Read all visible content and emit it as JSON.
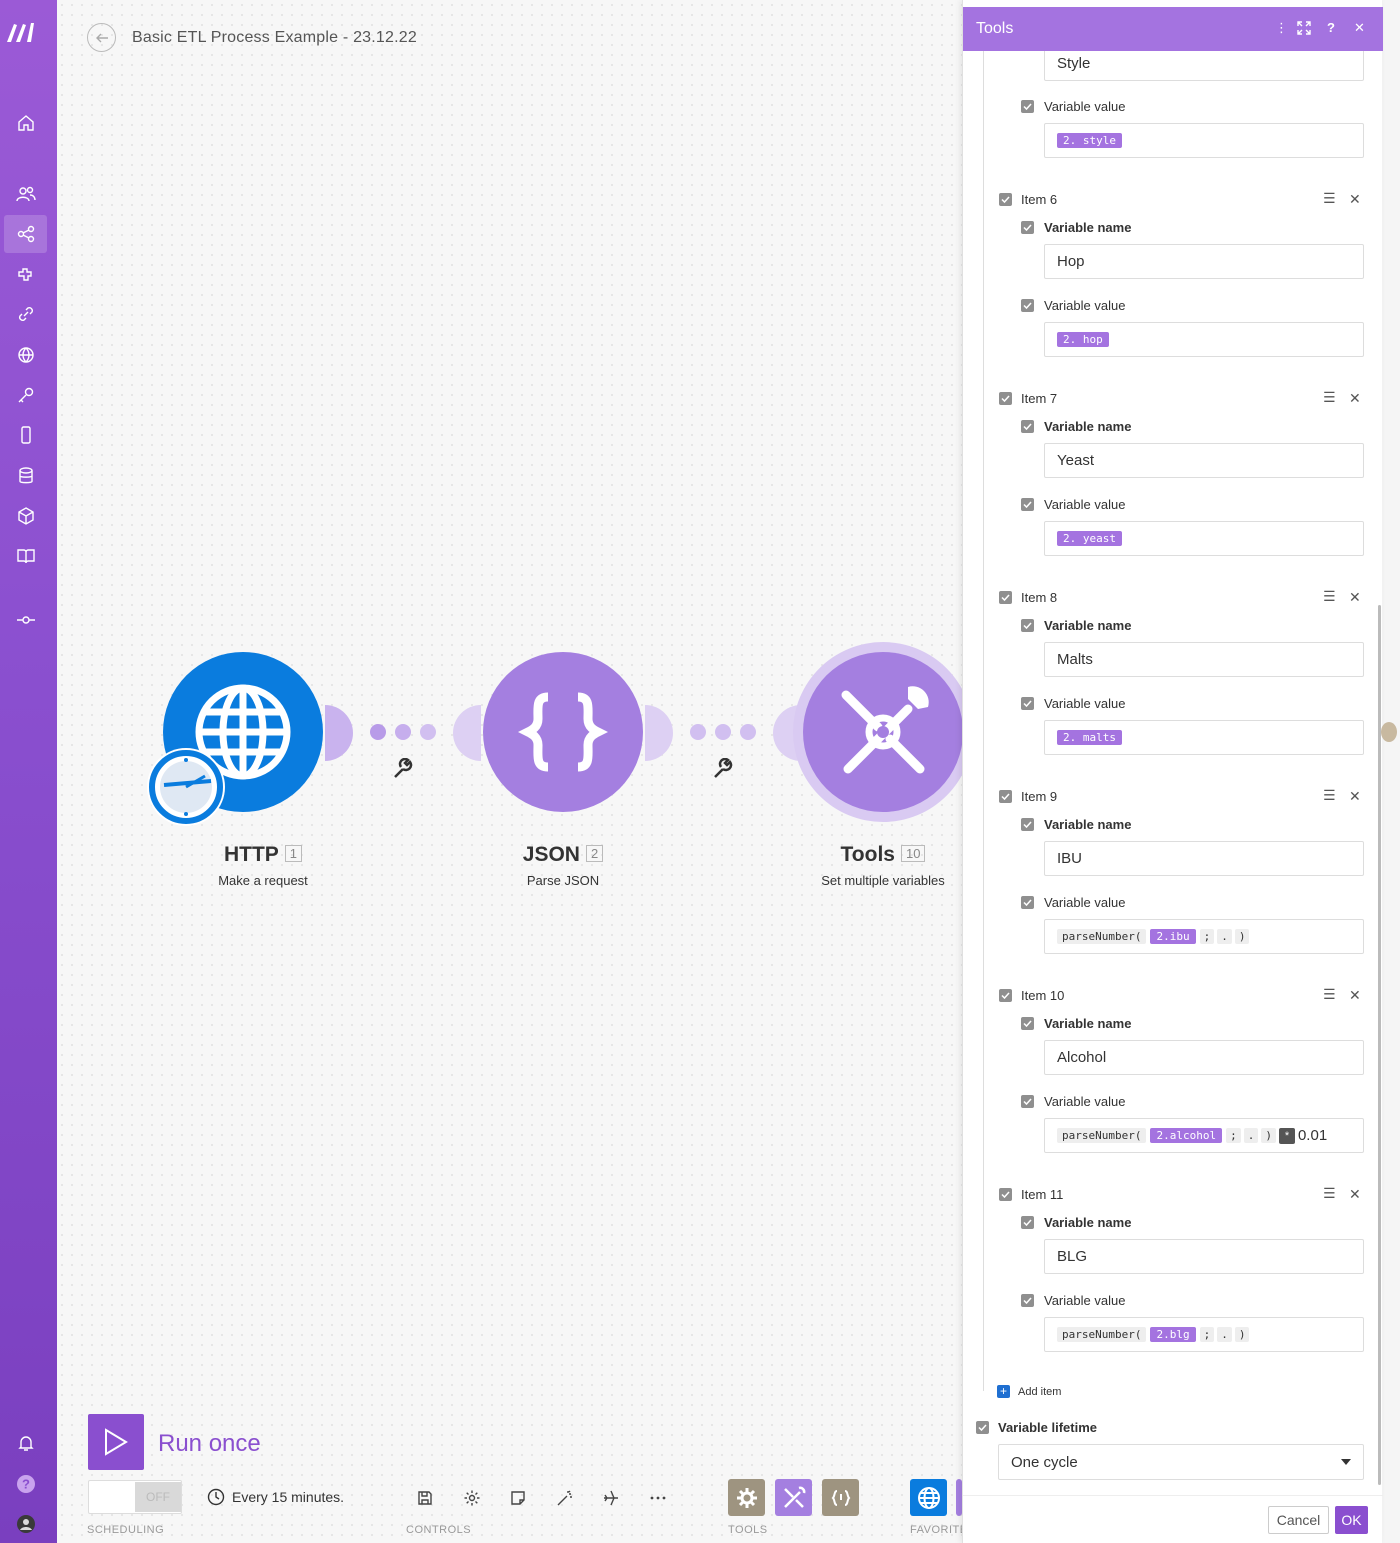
{
  "app": {
    "title": "Basic ETL Process Example - 23.12.22"
  },
  "sidebar": {
    "items": [
      {
        "icon": "home-icon"
      },
      {
        "icon": "team-icon"
      },
      {
        "icon": "scenarios-icon",
        "active": true
      },
      {
        "icon": "templates-icon"
      },
      {
        "icon": "connections-icon"
      },
      {
        "icon": "webhooks-icon"
      },
      {
        "icon": "keys-icon"
      },
      {
        "icon": "devices-icon"
      },
      {
        "icon": "data-stores-icon"
      },
      {
        "icon": "data-structures-icon"
      },
      {
        "icon": "docs-icon"
      },
      {
        "icon": "timeline-icon"
      },
      {
        "icon": "notifications-icon"
      },
      {
        "icon": "help-icon"
      },
      {
        "icon": "profile-icon"
      }
    ]
  },
  "modules": [
    {
      "name": "HTTP",
      "number": "1",
      "subtitle": "Make a request",
      "color": "#0a7cde"
    },
    {
      "name": "JSON",
      "number": "2",
      "subtitle": "Parse JSON",
      "color": "#a47fe0"
    },
    {
      "name": "Tools",
      "number": "10",
      "subtitle": "Set multiple variables",
      "color": "#a47fe0"
    }
  ],
  "bottom": {
    "run_label": "Run once",
    "toggle_label": "OFF",
    "schedule_text": "Every 15 minutes.",
    "labels": {
      "scheduling": "SCHEDULING",
      "controls": "CONTROLS",
      "tools": "TOOLS",
      "favorites": "FAVORITE"
    }
  },
  "panel": {
    "title": "Tools",
    "top_field_value": "Style",
    "top_var_value_label": "Variable value",
    "top_pill": "2. style",
    "items": [
      {
        "label": "Item 6",
        "name_label": "Variable name",
        "name": "Hop",
        "value_label": "Variable value",
        "pill": "2. hop"
      },
      {
        "label": "Item 7",
        "name_label": "Variable name",
        "name": "Yeast",
        "value_label": "Variable value",
        "pill": "2. yeast"
      },
      {
        "label": "Item 8",
        "name_label": "Variable name",
        "name": "Malts",
        "value_label": "Variable value",
        "pill": "2. malts"
      },
      {
        "label": "Item 9",
        "name_label": "Variable name",
        "name": "IBU",
        "value_label": "Variable value",
        "fn": "parseNumber(",
        "pill": "2.ibu",
        "sep1": ";",
        "sep2": ".",
        "close": ")"
      },
      {
        "label": "Item 10",
        "name_label": "Variable name",
        "name": "Alcohol",
        "value_label": "Variable value",
        "fn": "parseNumber(",
        "pill": "2.alcohol",
        "sep1": ";",
        "sep2": ".",
        "close": ")",
        "mult": "*",
        "suffix": "0.01"
      },
      {
        "label": "Item 11",
        "name_label": "Variable name",
        "name": "BLG",
        "value_label": "Variable value",
        "fn": "parseNumber(",
        "pill": "2.blg",
        "sep1": ";",
        "sep2": ".",
        "close": ")"
      }
    ],
    "add_item": "Add item",
    "lifetime_label": "Variable lifetime",
    "lifetime_value": "One cycle",
    "cancel": "Cancel",
    "ok": "OK"
  },
  "colors": {
    "accent": "#8a4fcf",
    "panel_header": "#a473e0",
    "http": "#0a7cde",
    "ok_button": "#8a4fcf"
  }
}
